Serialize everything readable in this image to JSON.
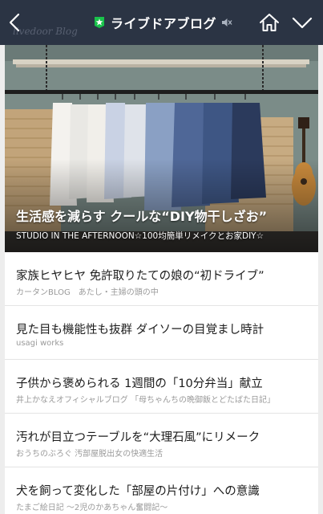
{
  "header": {
    "title": "ライブドアブログ",
    "ghost_text": "livedoor Blog",
    "colors": {
      "bar": "#2b3444",
      "badge": "#19c24b"
    },
    "icons": [
      "back-icon",
      "star-badge-icon",
      "mute-icon",
      "home-icon",
      "chevron-down-icon"
    ]
  },
  "hero": {
    "title": "生活感を減らす クールな“DIY物干しざお”",
    "source": "STUDIO IN THE AFTERNOON☆100均簡単リメイクとお家DIY☆"
  },
  "articles": [
    {
      "title": "家族ヒヤヒヤ 免許取りたての娘の“初ドライブ”",
      "source": "カータンBLOG　あたし・主婦の頭の中"
    },
    {
      "title": "見た目も機能性も抜群 ダイソーの目覚まし時計",
      "source": "usagi works"
    },
    {
      "title": "子供から褒められる 1週間の「10分弁当」献立",
      "source": "井上かなえオフィシャルブログ 「母ちゃんちの晩御飯とどたばた日記」"
    },
    {
      "title": "汚れが目立つテーブルを“大理石風”にリメーク",
      "source": "おうちのぶろぐ 汚部屋脱出女の快適生活"
    },
    {
      "title": "犬を飼って変化した「部屋の片付け」への意識",
      "source": "たまご絵日記 ～2児のかあちゃん奮闘記～"
    }
  ]
}
